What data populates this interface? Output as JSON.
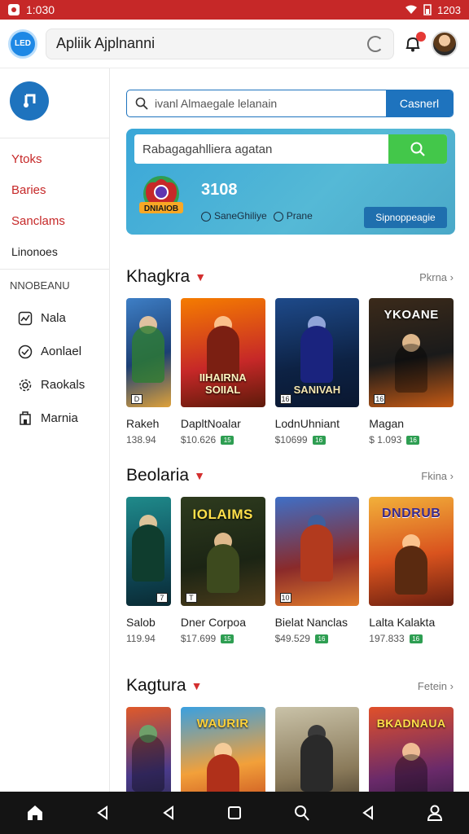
{
  "status": {
    "time": "1:030",
    "battery": "1203"
  },
  "topbar": {
    "logo": "LED",
    "title": "Apliik Ajplnanni"
  },
  "sidebar": {
    "links": [
      "Ytoks",
      "Baries",
      "Sanclams",
      "Linonoes"
    ],
    "section_label": "NNOBEANU",
    "nav": [
      {
        "label": "Nala",
        "icon": "chart-icon"
      },
      {
        "label": "Aonlael",
        "icon": "check-circle-icon"
      },
      {
        "label": "Raokals",
        "icon": "gear-icon"
      },
      {
        "label": "Marnia",
        "icon": "building-icon"
      }
    ]
  },
  "search": {
    "placeholder": "ivanl Almaegale lelanain",
    "button": "Casnerl"
  },
  "promo": {
    "search_placeholder": "Rabagagahlliera agatan",
    "logo_text": "DNIAIOB",
    "number": "3108",
    "radio_a": "SaneGhiliye",
    "radio_b": "Prane",
    "button": "Sipnoppeagie"
  },
  "sections": [
    {
      "title": "Khagkra",
      "more": "Pkrna",
      "cards": [
        {
          "name": "Rakeh",
          "price": "138.94",
          "badge": "",
          "art_top": "",
          "art_bottom": ""
        },
        {
          "name": "DapltNoalar",
          "price": "$10.626",
          "badge": "15",
          "art_top": "",
          "art_bottom": "IIHAIRNA SOIIAL"
        },
        {
          "name": "LodnUhniant",
          "price": "$10699",
          "badge": "16",
          "art_top": "",
          "art_bottom": "SANIVAH"
        },
        {
          "name": "Magan",
          "price": "$ 1.093",
          "badge": "16",
          "art_top": "YKOANE",
          "art_bottom": ""
        }
      ]
    },
    {
      "title": "Beolaria",
      "more": "Fkina",
      "cards": [
        {
          "name": "Salob",
          "price": "119.94",
          "badge": "",
          "art_top": "",
          "art_bottom": ""
        },
        {
          "name": "Dner Corpoa",
          "price": "$17.699",
          "badge": "15",
          "art_top": "IOLAIMS",
          "art_bottom": ""
        },
        {
          "name": "Bielat Nanclas",
          "price": "$49.529",
          "badge": "16",
          "art_top": "",
          "art_bottom": ""
        },
        {
          "name": "Lalta Kalakta",
          "price": "197.833",
          "badge": "16",
          "art_top": "DNDRUB",
          "art_bottom": ""
        }
      ]
    },
    {
      "title": "Kagtura",
      "more": "Fetein",
      "cards": [
        {
          "name": "",
          "price": "",
          "badge": "",
          "art_top": "",
          "art_bottom": ""
        },
        {
          "name": "",
          "price": "",
          "badge": "",
          "art_top": "WAURIR",
          "art_bottom": ""
        },
        {
          "name": "",
          "price": "",
          "badge": "",
          "art_top": "",
          "art_bottom": ""
        },
        {
          "name": "",
          "price": "",
          "badge": "",
          "art_top": "BKADNAUA",
          "art_bottom": ""
        }
      ]
    }
  ],
  "colors": {
    "accent_red": "#c62828",
    "brand_blue": "#1e73be",
    "promo_teal": "#3aa7d8",
    "go_green": "#43c74a"
  },
  "bottom_nav": [
    "home-icon",
    "back-icon",
    "back-icon",
    "recents-icon",
    "profile-icon",
    "back-icon",
    "account-icon"
  ]
}
